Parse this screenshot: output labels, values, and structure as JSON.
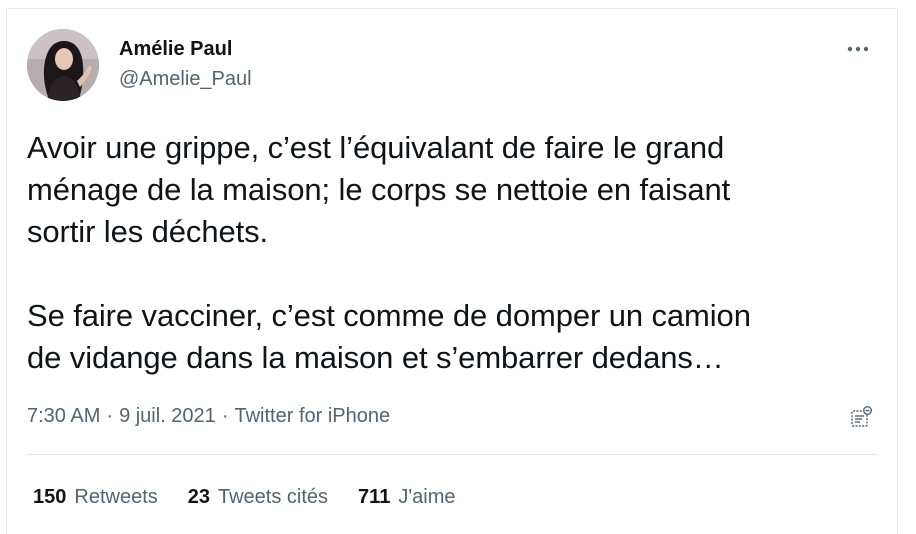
{
  "tweet": {
    "author_name": "Amélie Paul",
    "author_handle": "@Amelie_Paul",
    "text": "Avoir une grippe, c’est l’équivalant de faire le grand\nménage de la maison; le corps se nettoie en faisant\nsortir les déchets.\n\nSe faire vacciner, c’est comme de domper un camion\nde vidange dans la maison et s’embarrer dedans…",
    "time": "7:30 AM",
    "date": "9 juil. 2021",
    "source": "Twitter for iPhone",
    "separator": "·"
  },
  "stats": {
    "retweets_count": "150",
    "retweets_label": "Retweets",
    "quotes_count": "23",
    "quotes_label": "Tweets cités",
    "likes_count": "711",
    "likes_label": "J'aime"
  },
  "icons": {
    "more": "more-horizontal-icon",
    "analytics": "analytics-icon"
  },
  "colors": {
    "text_primary": "#0f1419",
    "text_secondary": "#536471",
    "border": "#e1e8ed"
  }
}
